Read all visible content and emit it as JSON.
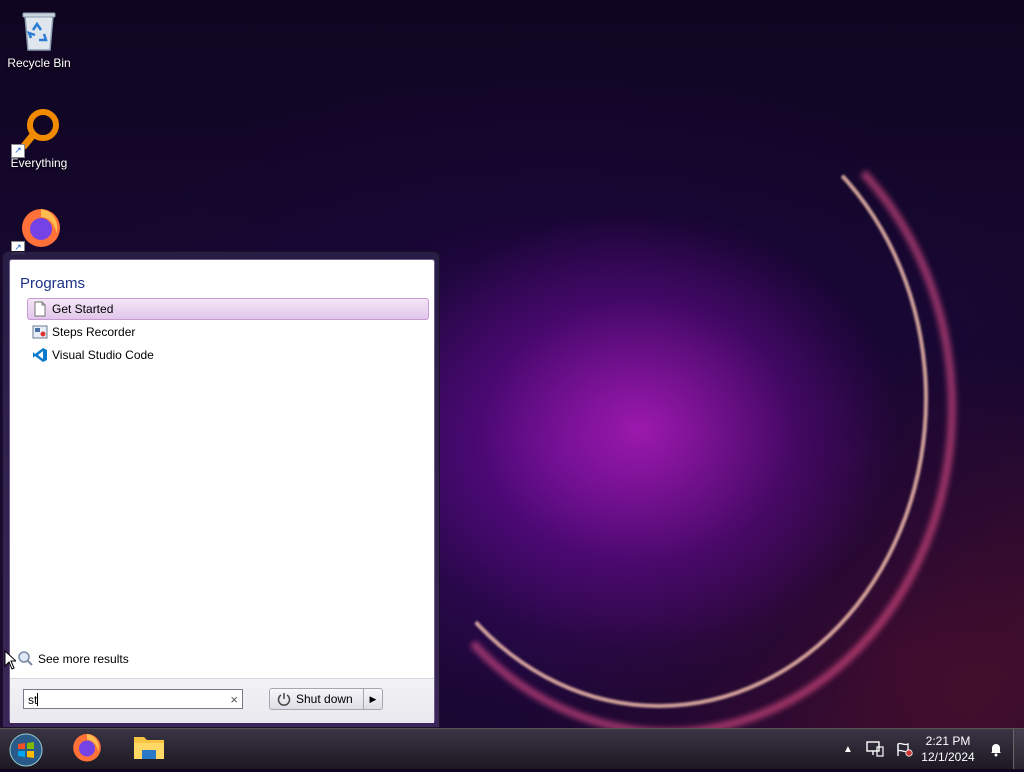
{
  "desktop": {
    "icons": [
      {
        "label": "Recycle Bin",
        "icon": "recycle-bin-icon"
      },
      {
        "label": "Everything",
        "icon": "everything-search-icon"
      },
      {
        "label": "",
        "icon": "firefox-icon"
      }
    ]
  },
  "start_menu": {
    "section_title": "Programs",
    "programs": [
      {
        "label": "Get Started",
        "icon": "document-icon",
        "selected": true
      },
      {
        "label": "Steps Recorder",
        "icon": "steps-recorder-icon",
        "selected": false
      },
      {
        "label": "Visual Studio Code",
        "icon": "vscode-icon",
        "selected": false
      }
    ],
    "see_more": "See more results",
    "search_value": "st",
    "clear_symbol": "×",
    "shutdown_label": "Shut down"
  },
  "taskbar": {
    "pinned": [
      "firefox-icon",
      "file-explorer-icon"
    ],
    "tray_icons": [
      "show-hidden-icons-chevron",
      "network-icon",
      "action-center-flag-icon",
      "notification-bell-icon"
    ],
    "time": "2:21 PM",
    "date": "12/1/2024"
  },
  "colors": {
    "accent": "#1e3287",
    "selection_bg": "#e9d3ef",
    "selection_border": "#c79bd2"
  }
}
